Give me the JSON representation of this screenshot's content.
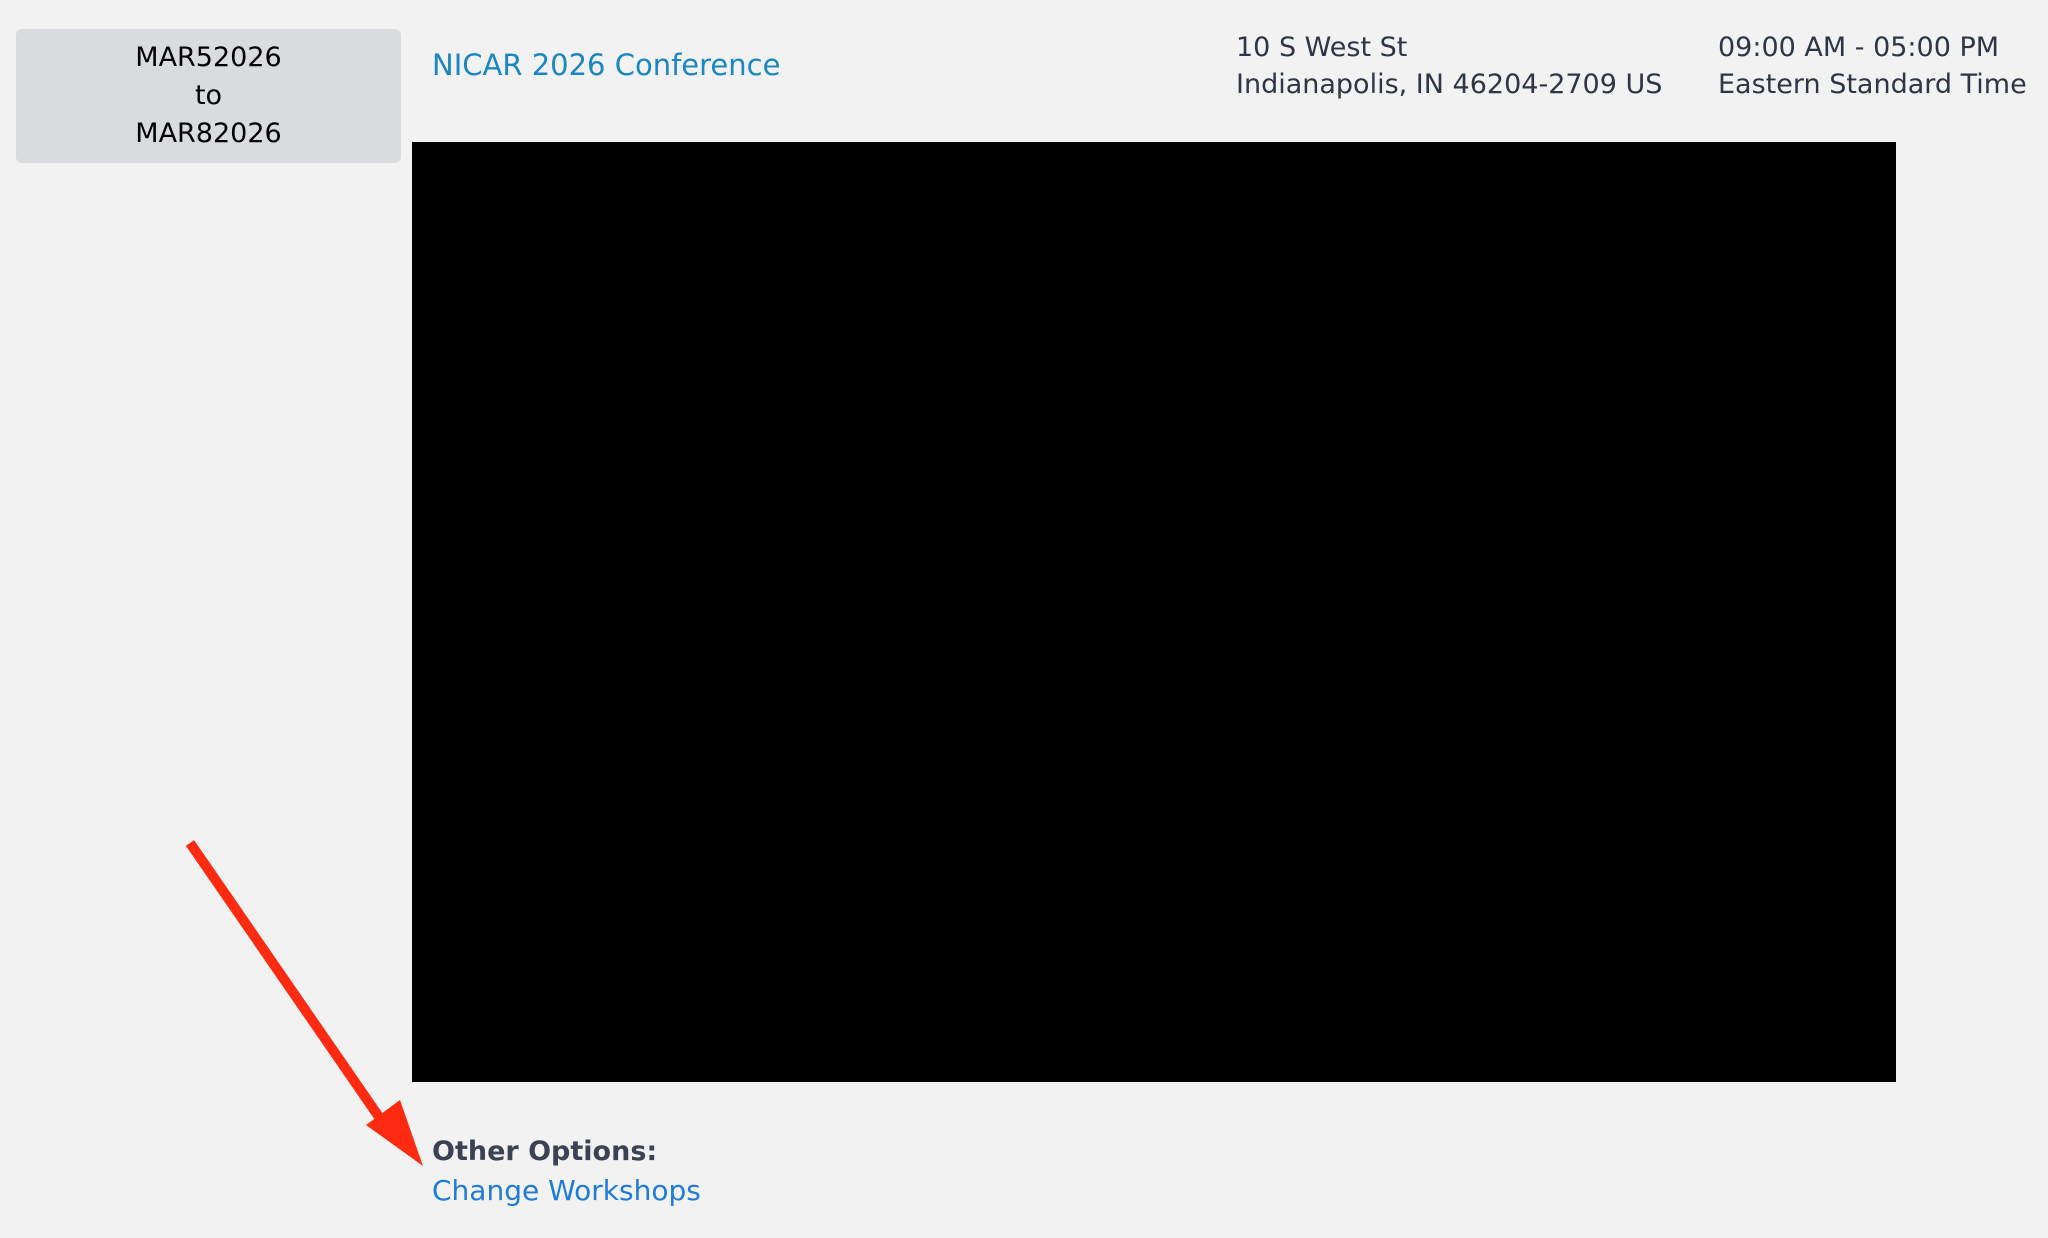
{
  "date_range": {
    "start": "MAR52026",
    "separator": "to",
    "end": "MAR82026"
  },
  "event": {
    "title": "NICAR 2026 Conference"
  },
  "location": {
    "street": "10 S West St",
    "city_line": "Indianapolis, IN 46204-2709 US"
  },
  "schedule": {
    "hours": "09:00 AM - 05:00 PM",
    "timezone": "Eastern Standard Time"
  },
  "other_options": {
    "label": "Other Options:",
    "change_workshops": "Change Workshops"
  },
  "colors": {
    "background": "#f2f2f2",
    "date_box": "#d9dbdf",
    "title_link": "#1a86c4",
    "action_link": "#1f7bd9",
    "annotation_arrow": "#ff2a12",
    "redacted_area": "#000000"
  }
}
